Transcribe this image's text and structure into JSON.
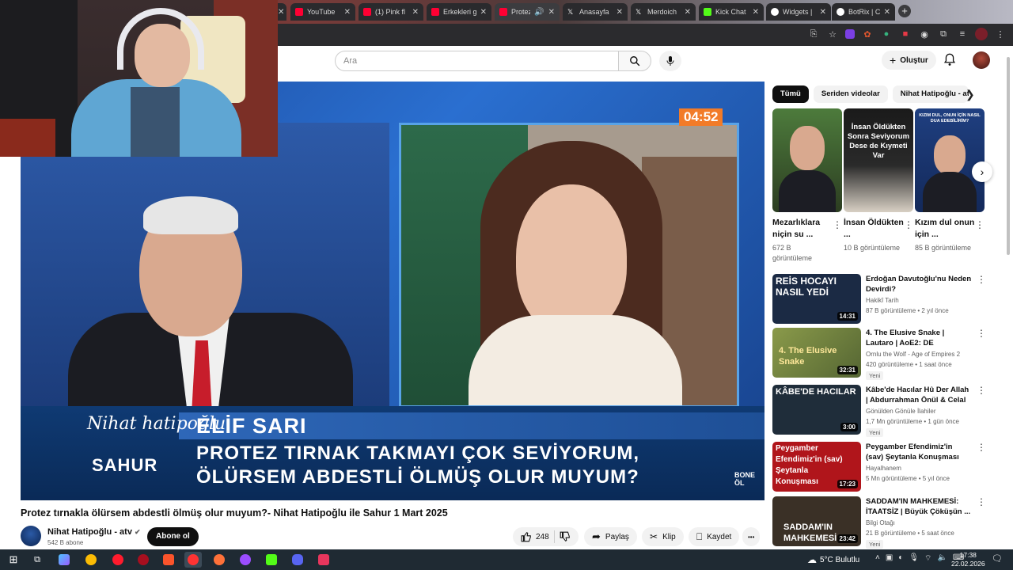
{
  "browser": {
    "tabs": [
      {
        "label": "",
        "color": "#ff0033"
      },
      {
        "label": "YouTube",
        "color": "#ff0033"
      },
      {
        "label": "(1) Pink fl",
        "color": "#ff0033"
      },
      {
        "label": "Erkekleri g",
        "color": "#ff0033"
      },
      {
        "label": "Protez",
        "color": "#ff0033",
        "active": true
      },
      {
        "label": "Anasayfa",
        "color": "#ffffff"
      },
      {
        "label": "Merdoich",
        "color": "#ffffff"
      },
      {
        "label": "Kick Chat",
        "color": "#53fc18"
      },
      {
        "label": "Widgets |",
        "color": "#ffffff"
      },
      {
        "label": "BotRix | C",
        "color": "#ffffff"
      }
    ],
    "new_tab_label": "+"
  },
  "youtube": {
    "search_placeholder": "Ara",
    "create_label": "Oluştur",
    "icons": {
      "search": "search-icon",
      "mic": "mic-icon",
      "bell": "bell-icon"
    }
  },
  "player": {
    "timer": "04:52",
    "overlay_name": "ELİF SARI",
    "overlay_line1": "PROTEZ TIRNAK TAKMAYI ÇOK SEVİYORUM,",
    "overlay_line2": "ÖLÜRSEM ABDESTLİ ÖLMÜŞ OLUR MUYUM?",
    "show_logo_1": "Nihat hatipoğlu",
    "show_logo_2": "SAHUR",
    "corner_logo": "BONE ÖL"
  },
  "video": {
    "title": "Protez tırnakla ölürsem abdestli ölmüş olur muyum?- Nihat Hatipoğlu ile Sahur 1 Mart 2025",
    "channel": "Nihat Hatipoğlu - atv",
    "subscribers": "542 B abone",
    "subscribe_label": "Abone ol",
    "likes": "248",
    "share_label": "Paylaş",
    "clip_label": "Klip",
    "save_label": "Kaydet",
    "more_label": "•••"
  },
  "sidebar": {
    "chips": [
      "Tümü",
      "Seriden videolar",
      "Nihat Hatipoğlu - atv"
    ],
    "shorts": [
      {
        "title": "Mezarlıklara niçin su ...",
        "views": "672 B görüntüleme",
        "caption": ""
      },
      {
        "title": "İnsan Öldükten ...",
        "views": "10 B görüntüleme",
        "caption": "İnsan Öldükten Sonra Seviyorum Dese de Kıymeti Var"
      },
      {
        "title": "Kızım dul onun için ...",
        "views": "85 B görüntüleme",
        "caption": "KIZIM DUL, ONUN İÇİN NASIL DUA EDEBİLİRİM?"
      }
    ],
    "recommendations": [
      {
        "title": "Erdoğan Davutoğlu'nu Neden Devirdi?",
        "channel": "Hakikî Tarih",
        "meta": "87 B görüntüleme • 2 yıl önce",
        "duration": "14:31",
        "caption": "REİS HOCAYI NASIL YEDİ",
        "badge": "",
        "thumb": "#1b2a44"
      },
      {
        "title": "4. The Elusive Snake | Lautaro | AoE2: DE",
        "channel": "Ornlu the Wolf - Age of Empires 2",
        "meta": "420 görüntüleme • 1 saat önce",
        "duration": "32:31",
        "caption": "4. The Elusive Snake",
        "badge": "Yeni",
        "thumb": "#6a7a3a"
      },
      {
        "title": "Kâbe'de Hacılar Hû Der Allah | Abdurrahman Önül & Celal ...",
        "channel": "Gönülden Gönüle İlahiler",
        "meta": "1,7 Mn görüntüleme • 1 gün önce",
        "duration": "3:00",
        "caption": "KÂBE'DE HACILAR",
        "badge": "Yeni",
        "thumb": "#1f2d3a"
      },
      {
        "title": "Peygamber Efendimiz'in (sav) Şeytanla Konuşması",
        "channel": "Hayalhanem",
        "meta": "5 Mn görüntüleme • 5 yıl önce",
        "duration": "17:23",
        "caption": "Peygamber Efendimiz'in (sav) Şeytanla Konuşması",
        "badge": "",
        "thumb": "#b0151b"
      },
      {
        "title": "SADDAM'IN MAHKEMESİ: İTAATSİZ | Büyük Çöküşün ...",
        "channel": "Bilgi Otağı",
        "meta": "21 B görüntüleme • 5 saat önce",
        "duration": "23:42",
        "caption": "SADDAM'IN MAHKEMESİ",
        "badge": "Yeni",
        "thumb": "#3a3026"
      }
    ]
  },
  "taskbar": {
    "weather": "5°C Bulutlu",
    "time": "17:38",
    "date": "22.02.2026"
  }
}
